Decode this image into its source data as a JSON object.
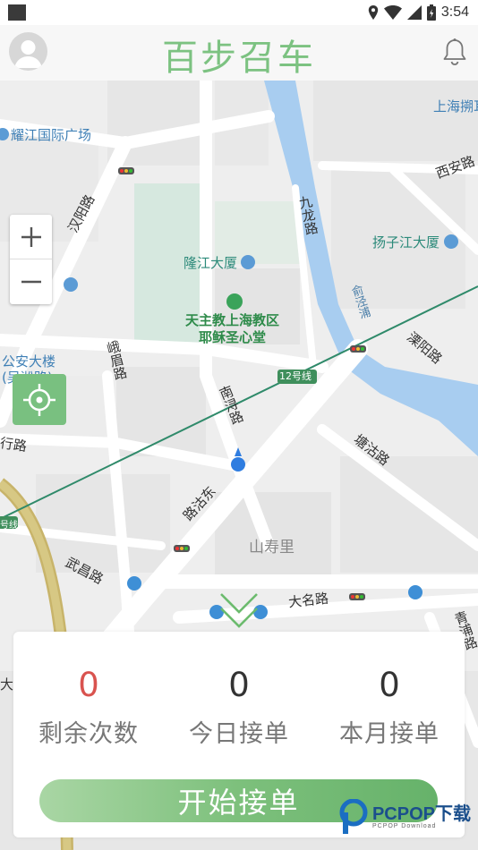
{
  "status_bar": {
    "time": "3:54"
  },
  "header": {
    "title": "百步召车"
  },
  "map": {
    "labels": {
      "yaojiang": "耀江国际广场",
      "shanghai_peng": "上海搠耳",
      "xian_road": "西安路",
      "hanyang_road": "汉阳路",
      "jiulong_road": "九龙路",
      "yangzijiang": "扬子江大厦",
      "longjiang": "隆江大厦",
      "church_line1": "天主教上海教区",
      "church_line2": "耶稣圣心堂",
      "yuxiepu": "俞泾浦",
      "liyang_road": "溧阳路",
      "security_line1": "公安大楼",
      "security_line2": "(吴淞路)",
      "emei_road": "峨眉路",
      "nanxun_road": "南浔路",
      "line12": "12号线",
      "hangzhou_road": "行路",
      "tangjia_road": "塘沽路",
      "tangjia_east": "路沽东",
      "shanshouli": "山寿里",
      "wuchang_road": "武昌路",
      "daming_road": "大名路",
      "qingpu": "青浦路",
      "line_left": "号线",
      "left_cut": "大厦"
    }
  },
  "stats": {
    "remaining": {
      "value": "0",
      "label": "剩余次数"
    },
    "today": {
      "value": "0",
      "label": "今日接单"
    },
    "month": {
      "value": "0",
      "label": "本月接单"
    }
  },
  "start_button": {
    "label": "开始接单"
  },
  "watermark": {
    "brand": "PCPOP下载",
    "sub": "PCPOP Download"
  },
  "colors": {
    "accent": "#7cc281",
    "alert_red": "#d9534f",
    "water": "#a8cdf0",
    "metro_line": "#2f8a6a"
  }
}
